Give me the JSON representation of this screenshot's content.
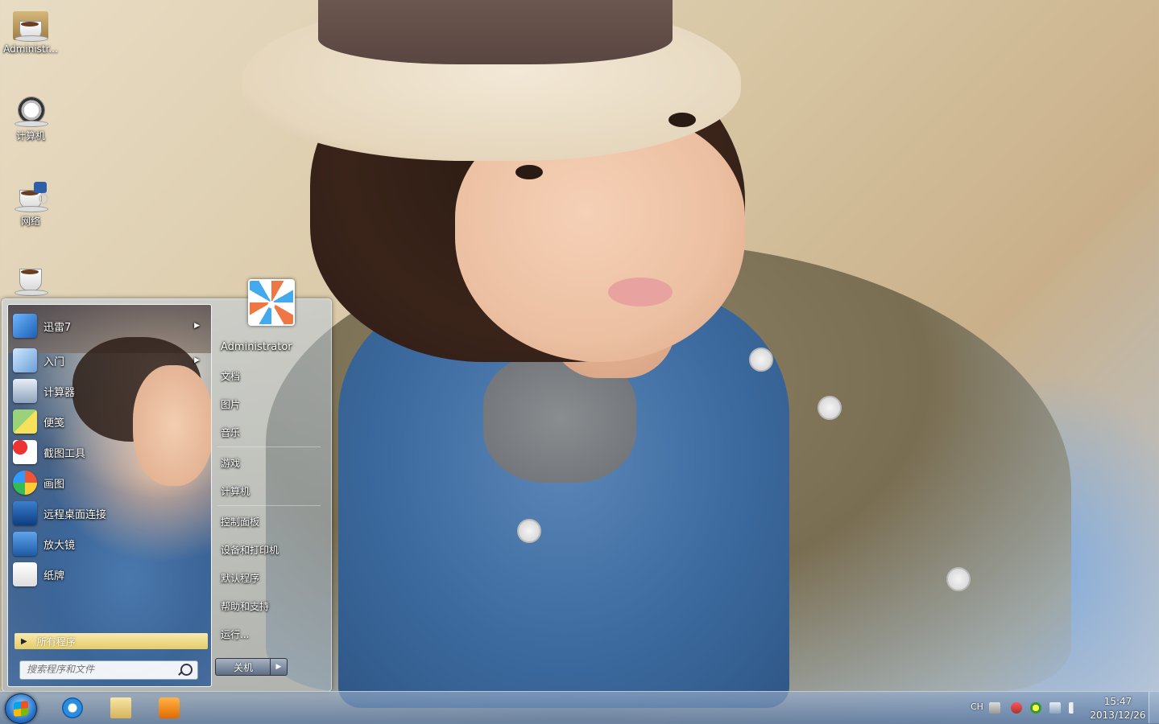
{
  "desktop": {
    "icons": [
      {
        "label": "Administr...",
        "icon": "user-folder-icon"
      },
      {
        "label": "计算机",
        "icon": "computer-icon"
      },
      {
        "label": "网络",
        "icon": "network-icon"
      },
      {
        "label": "",
        "icon": "recycle-bin-icon"
      }
    ]
  },
  "start_menu": {
    "programs": [
      {
        "label": "迅雷7",
        "icon": "thunder-icon",
        "has_submenu": true
      },
      {
        "label": "入门",
        "icon": "getting-started-icon",
        "has_submenu": true
      },
      {
        "label": "计算器",
        "icon": "calculator-icon",
        "has_submenu": false
      },
      {
        "label": "便笺",
        "icon": "sticky-notes-icon",
        "has_submenu": false
      },
      {
        "label": "截图工具",
        "icon": "snipping-tool-icon",
        "has_submenu": false
      },
      {
        "label": "画图",
        "icon": "paint-icon",
        "has_submenu": false
      },
      {
        "label": "远程桌面连接",
        "icon": "remote-desktop-icon",
        "has_submenu": false
      },
      {
        "label": "放大镜",
        "icon": "magnifier-icon",
        "has_submenu": false
      },
      {
        "label": "纸牌",
        "icon": "solitaire-icon",
        "has_submenu": false
      }
    ],
    "all_programs": "所有程序",
    "search_placeholder": "搜索程序和文件",
    "right": {
      "user": "Administrator",
      "group1": [
        "文档",
        "图片",
        "音乐"
      ],
      "group2": [
        "游戏",
        "计算机"
      ],
      "group3": [
        "控制面板",
        "设备和打印机",
        "默认程序",
        "帮助和支持",
        "运行..."
      ]
    },
    "shutdown_label": "关机"
  },
  "taskbar": {
    "pinned": [
      "internet-explorer-icon",
      "windows-explorer-icon",
      "media-player-icon"
    ],
    "tray": {
      "language": "CH"
    },
    "clock": {
      "time": "15:47",
      "date": "2013/12/26"
    }
  },
  "colors": {
    "accent": "#2b76c9",
    "all_programs_highlight": "#e6cd67"
  }
}
